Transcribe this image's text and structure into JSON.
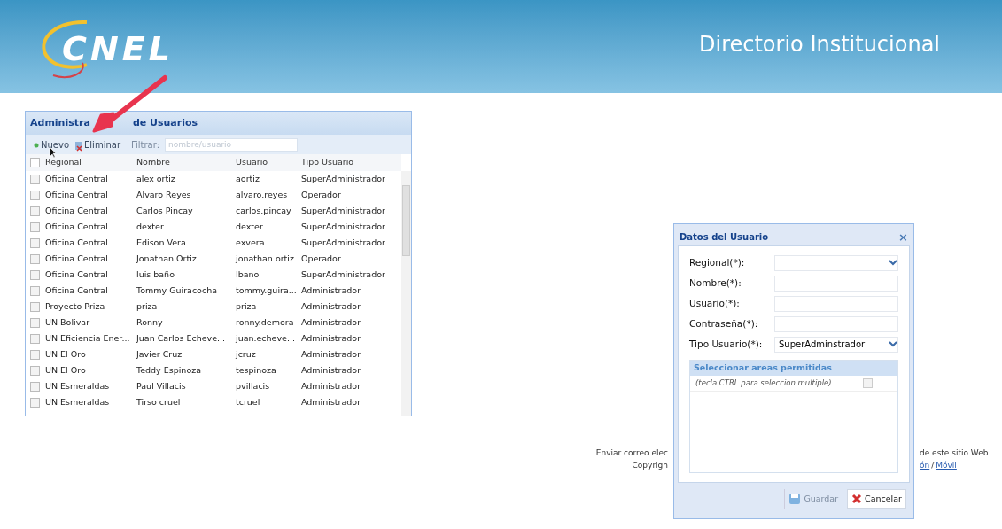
{
  "header": {
    "logo": "CNEL",
    "title": "Directorio Institucional"
  },
  "panel": {
    "title_start": "Administra",
    "title_end": "de Usuarios",
    "toolbar": {
      "buttons": [
        "Nuevo",
        "Eliminar"
      ],
      "filter_label": "Filtrar:",
      "filter_placeholder": "nombre/usuario"
    },
    "table": {
      "all_checked": false,
      "columns": [
        "Regional",
        "Nombre",
        "Usuario",
        "Tipo Usuario"
      ],
      "rows": [
        {
          "checked": false,
          "cells": [
            "Oficina Central",
            "alex ortiz",
            "aortiz",
            "SuperAdministrador"
          ]
        },
        {
          "checked": false,
          "cells": [
            "Oficina Central",
            "Alvaro Reyes",
            "alvaro.reyes",
            "Operador"
          ]
        },
        {
          "checked": false,
          "cells": [
            "Oficina Central",
            "Carlos Pincay",
            "carlos.pincay",
            "SuperAdministrador"
          ]
        },
        {
          "checked": false,
          "cells": [
            "Oficina Central",
            "dexter",
            "dexter",
            "SuperAdministrador"
          ]
        },
        {
          "checked": false,
          "cells": [
            "Oficina Central",
            "Edison Vera",
            "exvera",
            "SuperAdministrador"
          ]
        },
        {
          "checked": false,
          "cells": [
            "Oficina Central",
            "Jonathan Ortiz",
            "jonathan.ortiz",
            "Operador"
          ]
        },
        {
          "checked": false,
          "cells": [
            "Oficina Central",
            "luis baño",
            "lbano",
            "SuperAdministrador"
          ]
        },
        {
          "checked": false,
          "cells": [
            "Oficina Central",
            "Tommy Guiracocha",
            "tommy.guira...",
            "Administrador"
          ]
        },
        {
          "checked": false,
          "cells": [
            "Proyecto Priza",
            "priza",
            "priza",
            "Administrador"
          ]
        },
        {
          "checked": false,
          "cells": [
            "UN Bolivar",
            "Ronny",
            "ronny.demora",
            "Administrador"
          ]
        },
        {
          "checked": false,
          "cells": [
            "UN Eficiencia Ener...",
            "Juan Carlos Echeve...",
            "juan.echeve...",
            "Administrador"
          ]
        },
        {
          "checked": false,
          "cells": [
            "UN El Oro",
            "Javier Cruz",
            "jcruz",
            "Administrador"
          ]
        },
        {
          "checked": false,
          "cells": [
            "UN El Oro",
            "Teddy Espinoza",
            "tespinoza",
            "Administrador"
          ]
        },
        {
          "checked": false,
          "cells": [
            "UN Esmeraldas",
            "Paul Villacis",
            "pvillacis",
            "Administrador"
          ]
        },
        {
          "checked": false,
          "cells": [
            "UN Esmeraldas",
            "Tirso cruel",
            "tcruel",
            "Administrador"
          ]
        }
      ]
    }
  },
  "footer": {
    "left_lines": [
      "Enviar correo elec",
      "Copyrigh"
    ],
    "right_text": "de este sitio Web.",
    "links": [
      "ón",
      "Móvil"
    ],
    "separator": "/"
  },
  "dialog": {
    "title": "Datos del Usuario",
    "close": "×",
    "fields": [
      {
        "kind": "select",
        "label": "Regional(*):"
      },
      {
        "kind": "text",
        "label": "Nombre(*):"
      },
      {
        "kind": "text",
        "label": "Usuario(*):"
      },
      {
        "kind": "text",
        "label": "Contraseña(*):"
      },
      {
        "kind": "select",
        "label": "Tipo Usuario(*):",
        "value": "SuperAdminstrador"
      }
    ],
    "areas": {
      "title": "Seleccionar areas permitidas",
      "hint": "(tecla CTRL para seleccion multiple)",
      "checked": false
    },
    "buttons": [
      {
        "label": "Guardar",
        "disabled": true,
        "kind": "save"
      },
      {
        "label": "Cancelar",
        "disabled": false,
        "kind": "cancel"
      }
    ]
  }
}
